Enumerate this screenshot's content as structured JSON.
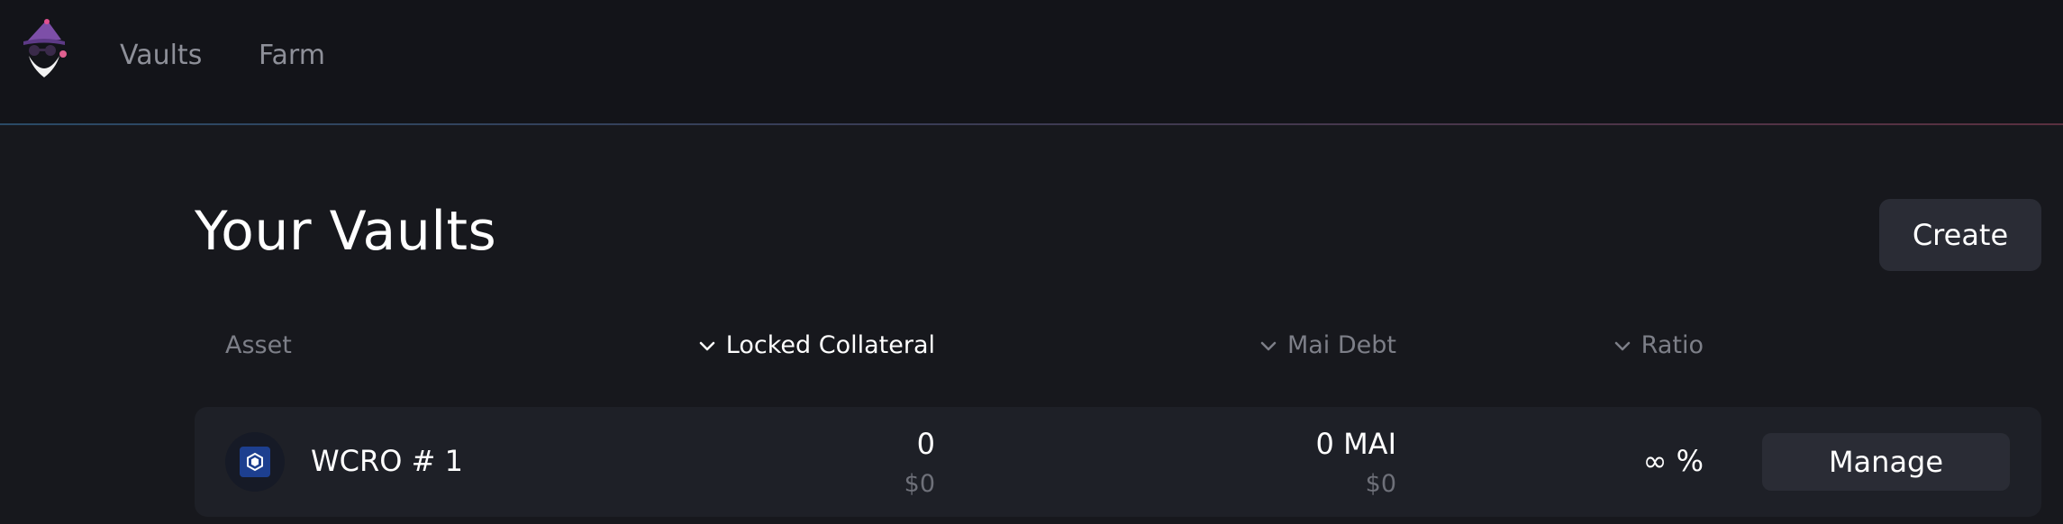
{
  "nav": {
    "items": [
      {
        "label": "Vaults"
      },
      {
        "label": "Farm"
      }
    ]
  },
  "page": {
    "title": "Your Vaults",
    "create_label": "Create"
  },
  "table": {
    "columns": {
      "asset": "Asset",
      "collateral": "Locked Collateral",
      "debt": "Mai Debt",
      "ratio": "Ratio"
    },
    "rows": [
      {
        "name": "WCRO # 1",
        "collateral": "0",
        "collateral_usd": "$0",
        "debt": "0 MAI",
        "debt_usd": "$0",
        "ratio": "∞ %",
        "action": "Manage"
      }
    ]
  },
  "colors": {
    "background": "#17181d",
    "topbar": "#131419",
    "button": "#2a2c35",
    "row": "#1e2027",
    "muted_text": "#7d7f88",
    "asset_icon": "#1d3f8f"
  },
  "icons": {
    "logo": "wizard-logo-icon",
    "sort": "chevron-down-icon",
    "asset": "cronos-token-icon"
  }
}
